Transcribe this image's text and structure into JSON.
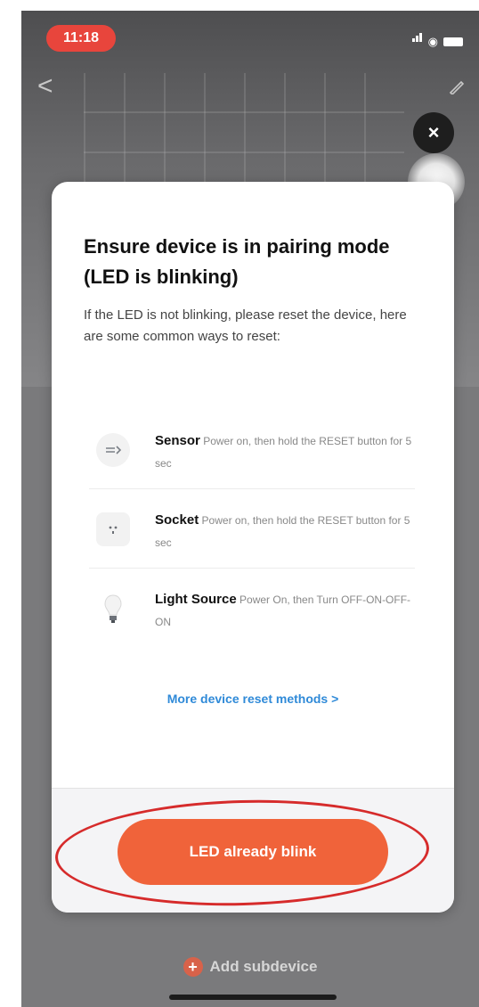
{
  "status_bar": {
    "time": "11:18"
  },
  "dialog": {
    "title": "Ensure device is in pairing mode (LED is blinking)",
    "description": "If the LED is not blinking, please reset the device, here are some common ways to reset:",
    "items": [
      {
        "name": "Sensor",
        "instruction": "Power on, then hold the RESET button for 5 sec",
        "icon": "sensor-icon"
      },
      {
        "name": "Socket",
        "instruction": "Power on, then hold the RESET button for 5 sec",
        "icon": "socket-icon"
      },
      {
        "name": "Light Source",
        "instruction": "Power On, then Turn OFF-ON-OFF-ON",
        "icon": "bulb-icon"
      }
    ],
    "more_link": "More device reset methods >",
    "primary_button": "LED already blink",
    "close_symbol": "×"
  },
  "background": {
    "add_subdevice_label": "Add subdevice",
    "back_symbol": "<"
  },
  "colors": {
    "accent": "#f0633a",
    "link": "#2f8ad8",
    "status_pill": "#e8453c",
    "annotation": "#d62b2b"
  }
}
